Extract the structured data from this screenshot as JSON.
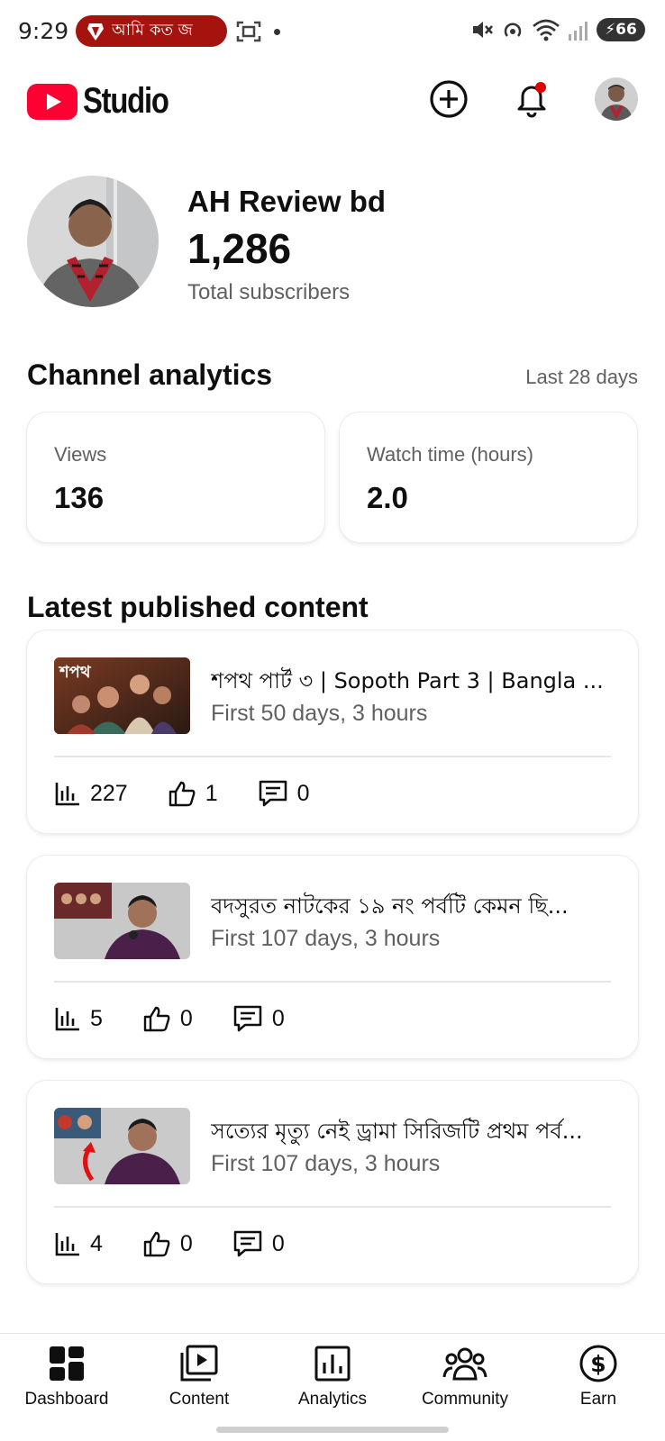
{
  "status_bar": {
    "time": "9:29",
    "notification_text": "আমি কত জ",
    "battery": "66"
  },
  "app": {
    "logo_text": "Studio",
    "brand_color": "#ff0033"
  },
  "channel": {
    "name": "AH Review bd",
    "subscribers": "1,286",
    "subscribers_label": "Total subscribers"
  },
  "analytics": {
    "title": "Channel analytics",
    "range": "Last 28 days",
    "cards": [
      {
        "label": "Views",
        "value": "136"
      },
      {
        "label": "Watch time (hours)",
        "value": "2.0"
      }
    ]
  },
  "latest": {
    "title": "Latest published content",
    "items": [
      {
        "title": "শপথ পার্ট ৩ | Sopoth Part 3  | Bangla ...",
        "subtitle": "First 50 days, 3 hours",
        "views": "227",
        "likes": "1",
        "comments": "0"
      },
      {
        "title": "বদসুরত নাটকের ১৯ নং পর্বটি কেমন ছি...",
        "subtitle": "First 107 days, 3 hours",
        "views": "5",
        "likes": "0",
        "comments": "0"
      },
      {
        "title": "সত্যের মৃত্যু নেই ড্রামা সিরিজটি প্রথম পর্ব...",
        "subtitle": "First 107 days, 3 hours",
        "views": "4",
        "likes": "0",
        "comments": "0"
      }
    ]
  },
  "nav": [
    {
      "label": "Dashboard",
      "icon": "dashboard-icon",
      "active": true
    },
    {
      "label": "Content",
      "icon": "content-icon"
    },
    {
      "label": "Analytics",
      "icon": "analytics-icon"
    },
    {
      "label": "Community",
      "icon": "community-icon"
    },
    {
      "label": "Earn",
      "icon": "earn-icon"
    }
  ]
}
